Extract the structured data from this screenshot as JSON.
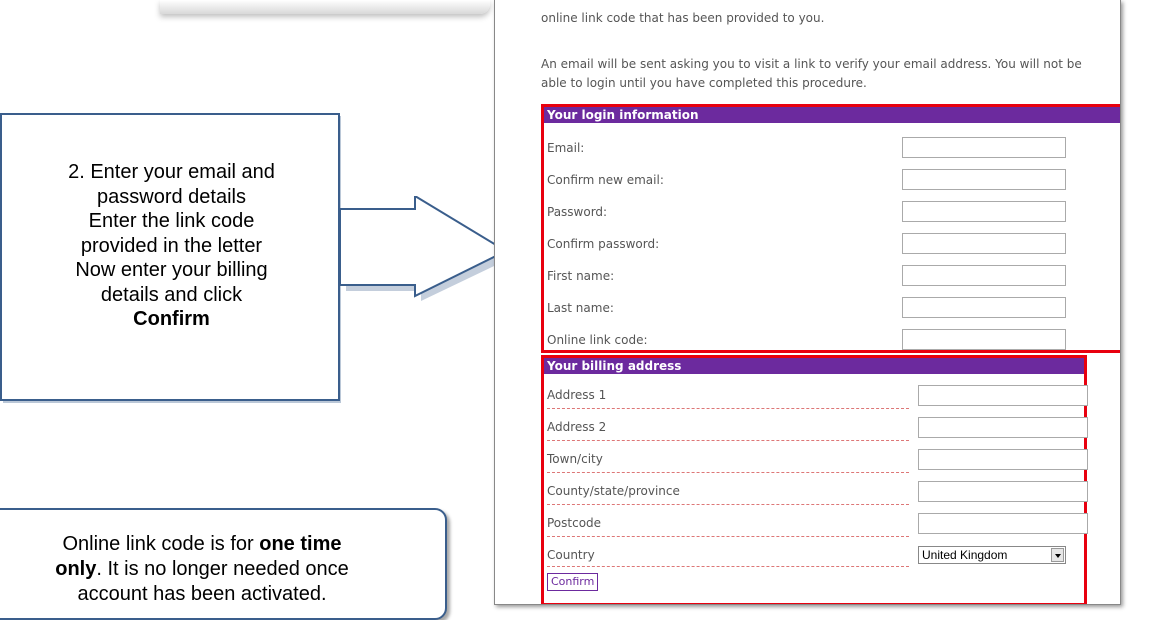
{
  "callout": {
    "lines": [
      "2. Enter your email and",
      "password details",
      "Enter the link code",
      "provided in the letter",
      "Now enter your billing",
      "details and click"
    ],
    "bold_word": "Confirm"
  },
  "note": {
    "line1_pre": "Online link code is for",
    "line1_bold": "one time",
    "line2_bold": "only",
    "line2_rest": ". It is no longer needed once",
    "line3": "account has been activated."
  },
  "page": {
    "intro_line": "online link code that has been provided to you.",
    "verify_text": "An email will be sent asking you to visit a link to verify your email address. You will not be able to login until you have completed this procedure."
  },
  "login": {
    "title": "Your login information",
    "fields": [
      "Email:",
      "Confirm new email:",
      "Password:",
      "Confirm password:",
      "First name:",
      "Last name:",
      "Online link code:"
    ]
  },
  "billing": {
    "title": "Your billing address",
    "fields": [
      "Address 1",
      "Address 2",
      "Town/city",
      "County/state/province",
      "Postcode"
    ],
    "country_label": "Country",
    "country_value": "United Kingdom",
    "confirm_label": "Confirm"
  },
  "colors": {
    "accent": "#6c2a9e",
    "highlight": "#e8000f",
    "callout_border": "#3a5e8c"
  }
}
